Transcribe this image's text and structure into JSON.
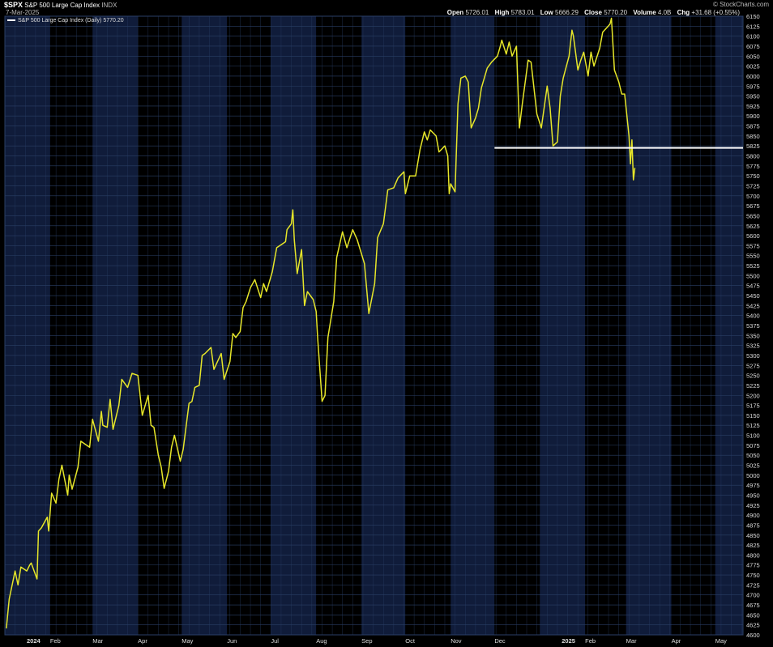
{
  "header": {
    "symbol": "$SPX",
    "name": "S&P 500 Large Cap Index",
    "exchange": "INDX",
    "date": "7-Mar-2025",
    "brand": "© StockCharts.com",
    "open_label": "Open",
    "open_value": "5726.01",
    "high_label": "High",
    "high_value": "5783.01",
    "low_label": "Low",
    "low_value": "5666.29",
    "close_label": "Close",
    "close_value": "5770.20",
    "volume_label": "Volume",
    "volume_value": "4.0B",
    "chg_label": "Chg",
    "chg_value": "+31.68 (+0.55%)"
  },
  "legend": {
    "label": "S&P 500 Large Cap Index (Daily) 5770.20"
  },
  "colors": {
    "background": "#000000",
    "band_light": "#101c3a",
    "band_dark": "#000000",
    "grid": "#2a3f66",
    "price_line": "#e6e629",
    "support_line": "#ffffff",
    "axis_text": "#dddddd"
  },
  "chart_data": {
    "type": "line",
    "title": "S&P 500 Large Cap Index (Daily) 5770.20",
    "xlabel": "",
    "ylabel": "",
    "ylim": [
      4600,
      6150
    ],
    "x_range": [
      "2024-01-01",
      "2025-05-20"
    ],
    "grid": true,
    "legend_position": "top-left",
    "y_ticks": [
      4600,
      4625,
      4650,
      4675,
      4700,
      4725,
      4750,
      4775,
      4800,
      4825,
      4850,
      4875,
      4900,
      4925,
      4950,
      4975,
      5000,
      5025,
      5050,
      5075,
      5100,
      5125,
      5150,
      5175,
      5200,
      5225,
      5250,
      5275,
      5300,
      5325,
      5350,
      5375,
      5400,
      5425,
      5450,
      5475,
      5500,
      5525,
      5550,
      5575,
      5600,
      5625,
      5650,
      5675,
      5700,
      5725,
      5750,
      5775,
      5800,
      5825,
      5850,
      5875,
      5900,
      5925,
      5950,
      5975,
      6000,
      6025,
      6050,
      6075,
      6100,
      6125,
      6150
    ],
    "x_ticks": [
      {
        "date": "2024-01-01",
        "label": "2024",
        "bold": true
      },
      {
        "date": "2024-02-01",
        "label": "Feb"
      },
      {
        "date": "2024-03-01",
        "label": "Mar"
      },
      {
        "date": "2024-04-01",
        "label": "Apr"
      },
      {
        "date": "2024-05-01",
        "label": "May"
      },
      {
        "date": "2024-06-01",
        "label": "Jun"
      },
      {
        "date": "2024-07-01",
        "label": "Jul"
      },
      {
        "date": "2024-08-01",
        "label": "Aug"
      },
      {
        "date": "2024-09-01",
        "label": "Sep"
      },
      {
        "date": "2024-10-01",
        "label": "Oct"
      },
      {
        "date": "2024-11-01",
        "label": "Nov"
      },
      {
        "date": "2024-12-01",
        "label": "Dec"
      },
      {
        "date": "2025-01-01",
        "label": "2025",
        "bold": true
      },
      {
        "date": "2025-02-01",
        "label": "Feb"
      },
      {
        "date": "2025-03-01",
        "label": "Mar"
      },
      {
        "date": "2025-04-01",
        "label": "Apr"
      },
      {
        "date": "2025-05-01",
        "label": "May"
      }
    ],
    "series": [
      {
        "name": "S&P 500 Large Cap Index (Daily)",
        "points": [
          [
            "2024-01-02",
            4616
          ],
          [
            "2024-01-04",
            4690
          ],
          [
            "2024-01-08",
            4760
          ],
          [
            "2024-01-10",
            4725
          ],
          [
            "2024-01-12",
            4770
          ],
          [
            "2024-01-16",
            4760
          ],
          [
            "2024-01-18",
            4775
          ],
          [
            "2024-01-19",
            4780
          ],
          [
            "2024-01-23",
            4740
          ],
          [
            "2024-01-24",
            4860
          ],
          [
            "2024-01-26",
            4868
          ],
          [
            "2024-01-30",
            4895
          ],
          [
            "2024-01-31",
            4860
          ],
          [
            "2024-02-02",
            4955
          ],
          [
            "2024-02-05",
            4930
          ],
          [
            "2024-02-07",
            4990
          ],
          [
            "2024-02-09",
            5025
          ],
          [
            "2024-02-13",
            4950
          ],
          [
            "2024-02-14",
            5000
          ],
          [
            "2024-02-16",
            4965
          ],
          [
            "2024-02-20",
            5020
          ],
          [
            "2024-02-22",
            5085
          ],
          [
            "2024-02-26",
            5075
          ],
          [
            "2024-02-28",
            5070
          ],
          [
            "2024-03-01",
            5140
          ],
          [
            "2024-03-05",
            5085
          ],
          [
            "2024-03-07",
            5160
          ],
          [
            "2024-03-08",
            5125
          ],
          [
            "2024-03-11",
            5120
          ],
          [
            "2024-03-13",
            5190
          ],
          [
            "2024-03-15",
            5115
          ],
          [
            "2024-03-19",
            5175
          ],
          [
            "2024-03-21",
            5240
          ],
          [
            "2024-03-25",
            5220
          ],
          [
            "2024-03-28",
            5255
          ],
          [
            "2024-04-01",
            5250
          ],
          [
            "2024-04-04",
            5150
          ],
          [
            "2024-04-08",
            5200
          ],
          [
            "2024-04-10",
            5125
          ],
          [
            "2024-04-12",
            5120
          ],
          [
            "2024-04-15",
            5050
          ],
          [
            "2024-04-17",
            5020
          ],
          [
            "2024-04-19",
            4967
          ],
          [
            "2024-04-22",
            5010
          ],
          [
            "2024-04-24",
            5070
          ],
          [
            "2024-04-26",
            5100
          ],
          [
            "2024-04-30",
            5035
          ],
          [
            "2024-05-02",
            5065
          ],
          [
            "2024-05-06",
            5180
          ],
          [
            "2024-05-08",
            5185
          ],
          [
            "2024-05-10",
            5220
          ],
          [
            "2024-05-13",
            5225
          ],
          [
            "2024-05-15",
            5300
          ],
          [
            "2024-05-17",
            5305
          ],
          [
            "2024-05-21",
            5320
          ],
          [
            "2024-05-23",
            5265
          ],
          [
            "2024-05-28",
            5305
          ],
          [
            "2024-05-30",
            5240
          ],
          [
            "2024-06-03",
            5285
          ],
          [
            "2024-06-05",
            5355
          ],
          [
            "2024-06-07",
            5345
          ],
          [
            "2024-06-10",
            5360
          ],
          [
            "2024-06-12",
            5420
          ],
          [
            "2024-06-14",
            5435
          ],
          [
            "2024-06-17",
            5470
          ],
          [
            "2024-06-20",
            5490
          ],
          [
            "2024-06-24",
            5445
          ],
          [
            "2024-06-26",
            5480
          ],
          [
            "2024-06-28",
            5460
          ],
          [
            "2024-07-02",
            5510
          ],
          [
            "2024-07-05",
            5570
          ],
          [
            "2024-07-09",
            5580
          ],
          [
            "2024-07-11",
            5585
          ],
          [
            "2024-07-12",
            5615
          ],
          [
            "2024-07-15",
            5630
          ],
          [
            "2024-07-16",
            5665
          ],
          [
            "2024-07-17",
            5590
          ],
          [
            "2024-07-19",
            5505
          ],
          [
            "2024-07-22",
            5565
          ],
          [
            "2024-07-24",
            5425
          ],
          [
            "2024-07-26",
            5460
          ],
          [
            "2024-07-30",
            5440
          ],
          [
            "2024-08-01",
            5410
          ],
          [
            "2024-08-02",
            5345
          ],
          [
            "2024-08-05",
            5185
          ],
          [
            "2024-08-07",
            5200
          ],
          [
            "2024-08-09",
            5345
          ],
          [
            "2024-08-13",
            5435
          ],
          [
            "2024-08-15",
            5545
          ],
          [
            "2024-08-19",
            5610
          ],
          [
            "2024-08-22",
            5570
          ],
          [
            "2024-08-26",
            5615
          ],
          [
            "2024-08-29",
            5590
          ],
          [
            "2024-09-03",
            5530
          ],
          [
            "2024-09-06",
            5405
          ],
          [
            "2024-09-10",
            5480
          ],
          [
            "2024-09-12",
            5595
          ],
          [
            "2024-09-16",
            5630
          ],
          [
            "2024-09-19",
            5715
          ],
          [
            "2024-09-23",
            5720
          ],
          [
            "2024-09-26",
            5745
          ],
          [
            "2024-09-30",
            5760
          ],
          [
            "2024-10-01",
            5705
          ],
          [
            "2024-10-04",
            5750
          ],
          [
            "2024-10-08",
            5750
          ],
          [
            "2024-10-11",
            5815
          ],
          [
            "2024-10-14",
            5860
          ],
          [
            "2024-10-16",
            5840
          ],
          [
            "2024-10-18",
            5865
          ],
          [
            "2024-10-22",
            5850
          ],
          [
            "2024-10-24",
            5810
          ],
          [
            "2024-10-28",
            5825
          ],
          [
            "2024-10-30",
            5800
          ],
          [
            "2024-10-31",
            5705
          ],
          [
            "2024-11-01",
            5730
          ],
          [
            "2024-11-04",
            5710
          ],
          [
            "2024-11-06",
            5930
          ],
          [
            "2024-11-08",
            5995
          ],
          [
            "2024-11-11",
            6000
          ],
          [
            "2024-11-13",
            5985
          ],
          [
            "2024-11-15",
            5870
          ],
          [
            "2024-11-18",
            5895
          ],
          [
            "2024-11-20",
            5920
          ],
          [
            "2024-11-22",
            5970
          ],
          [
            "2024-11-26",
            6020
          ],
          [
            "2024-11-29",
            6035
          ],
          [
            "2024-12-03",
            6050
          ],
          [
            "2024-12-05",
            6075
          ],
          [
            "2024-12-06",
            6090
          ],
          [
            "2024-12-09",
            6055
          ],
          [
            "2024-12-11",
            6085
          ],
          [
            "2024-12-13",
            6050
          ],
          [
            "2024-12-16",
            6075
          ],
          [
            "2024-12-18",
            5870
          ],
          [
            "2024-12-20",
            5930
          ],
          [
            "2024-12-24",
            6040
          ],
          [
            "2024-12-26",
            6035
          ],
          [
            "2024-12-30",
            5905
          ],
          [
            "2025-01-02",
            5870
          ],
          [
            "2025-01-06",
            5975
          ],
          [
            "2025-01-08",
            5920
          ],
          [
            "2025-01-10",
            5825
          ],
          [
            "2025-01-13",
            5835
          ],
          [
            "2025-01-15",
            5950
          ],
          [
            "2025-01-17",
            5995
          ],
          [
            "2025-01-21",
            6050
          ],
          [
            "2025-01-23",
            6115
          ],
          [
            "2025-01-24",
            6100
          ],
          [
            "2025-01-27",
            6015
          ],
          [
            "2025-01-29",
            6040
          ],
          [
            "2025-01-31",
            6060
          ],
          [
            "2025-02-03",
            6000
          ],
          [
            "2025-02-05",
            6060
          ],
          [
            "2025-02-07",
            6025
          ],
          [
            "2025-02-11",
            6070
          ],
          [
            "2025-02-13",
            6110
          ],
          [
            "2025-02-18",
            6130
          ],
          [
            "2025-02-19",
            6145
          ],
          [
            "2025-02-21",
            6015
          ],
          [
            "2025-02-24",
            5985
          ],
          [
            "2025-02-26",
            5955
          ],
          [
            "2025-02-28",
            5955
          ],
          [
            "2025-03-03",
            5850
          ],
          [
            "2025-03-04",
            5780
          ],
          [
            "2025-03-05",
            5840
          ],
          [
            "2025-03-06",
            5740
          ],
          [
            "2025-03-07",
            5770
          ]
        ]
      }
    ],
    "annotations": [
      {
        "type": "horizontal_line",
        "y": 5820,
        "x_start": "2024-12-01",
        "x_end": "2025-05-20"
      }
    ]
  }
}
